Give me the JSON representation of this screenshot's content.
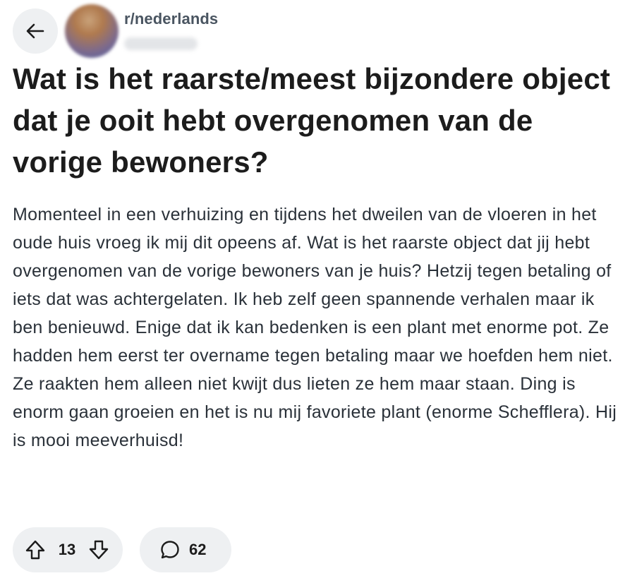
{
  "header": {
    "subreddit": "r/nederlands",
    "back_icon": "arrow-left-icon"
  },
  "post": {
    "title": "Wat is het raarste/meest bijzondere object dat je ooit hebt overgenomen van de vorige bewoners?",
    "body": "Momenteel in een verhuizing en tijdens het dweilen van de vloeren in het oude huis vroeg ik mij dit opeens af. Wat is het raarste object dat jij hebt overgenomen van de vorige bewoners van je huis? Hetzij tegen betaling of iets dat was achtergelaten. Ik heb zelf geen spannende verhalen maar ik ben benieuwd. Enige dat ik kan bedenken is een plant met enorme pot. Ze hadden hem eerst ter overname tegen betaling maar we hoefden hem niet. Ze raakten hem alleen niet kwijt dus lieten ze hem maar staan. Ding is enorm gaan groeien en het is nu mij favoriete plant (enorme Schefflera). Hij is mooi meeverhuisd!"
  },
  "actions": {
    "vote_count": "13",
    "comment_count": "62",
    "upvote_icon": "arrow-up-icon",
    "downvote_icon": "arrow-down-icon",
    "comment_icon": "speech-bubble-icon"
  },
  "colors": {
    "pill_background": "#eef0f2",
    "title_text": "#1c1c1c",
    "body_text": "#2a3139",
    "subreddit_text": "#4a5561"
  }
}
